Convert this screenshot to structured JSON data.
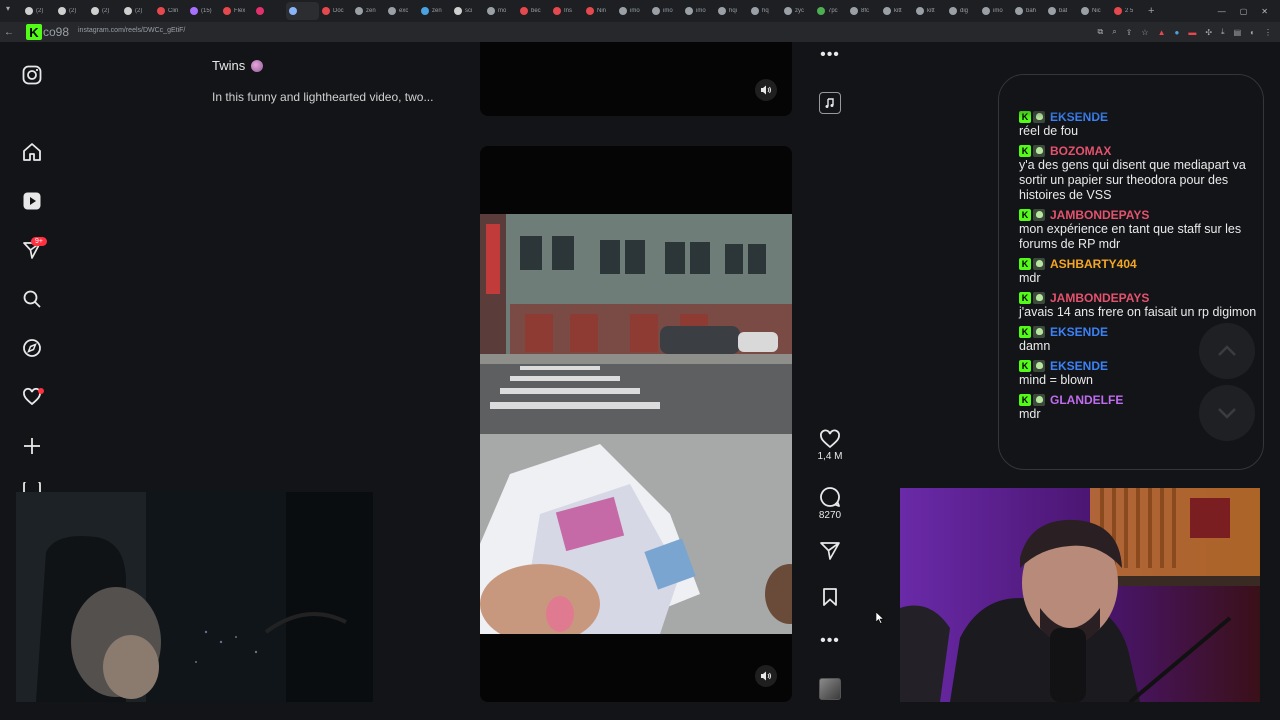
{
  "browser": {
    "tabs": [
      {
        "label": "(2)",
        "color": "#cfcfcf"
      },
      {
        "label": "(2)",
        "color": "#cfcfcf"
      },
      {
        "label": "(2)",
        "color": "#cfcfcf"
      },
      {
        "label": "(2)",
        "color": "#cfcfcf"
      },
      {
        "label": "Clin",
        "color": "#e5484d"
      },
      {
        "label": "(15)",
        "color": "#a970ff"
      },
      {
        "label": "Flex",
        "color": "#e5484d"
      },
      {
        "label": "",
        "color": "#e1306c"
      },
      {
        "label": "",
        "color": "#8ab4f8"
      },
      {
        "label": "Doc",
        "color": "#e5484d"
      },
      {
        "label": "zen",
        "color": "#9aa0a6"
      },
      {
        "label": "exc",
        "color": "#9aa0a6"
      },
      {
        "label": "zen",
        "color": "#4aa3df"
      },
      {
        "label": "sci",
        "color": "#cfcfcf"
      },
      {
        "label": "mo",
        "color": "#9aa0a6"
      },
      {
        "label": "bec",
        "color": "#e5484d"
      },
      {
        "label": "Ins",
        "color": "#e5484d"
      },
      {
        "label": "Nin",
        "color": "#e5484d"
      },
      {
        "label": "imo",
        "color": "#9aa0a6"
      },
      {
        "label": "imo",
        "color": "#9aa0a6"
      },
      {
        "label": "imo",
        "color": "#9aa0a6"
      },
      {
        "label": "hqi",
        "color": "#9aa0a6"
      },
      {
        "label": "hq",
        "color": "#9aa0a6"
      },
      {
        "label": "zyc",
        "color": "#9aa0a6"
      },
      {
        "label": "7pc",
        "color": "#4caf50"
      },
      {
        "label": "8fc",
        "color": "#9aa0a6"
      },
      {
        "label": "kitt",
        "color": "#9aa0a6"
      },
      {
        "label": "kitt",
        "color": "#9aa0a6"
      },
      {
        "label": "dig",
        "color": "#9aa0a6"
      },
      {
        "label": "imo",
        "color": "#9aa0a6"
      },
      {
        "label": "bah",
        "color": "#9aa0a6"
      },
      {
        "label": "bat",
        "color": "#9aa0a6"
      },
      {
        "label": "Nic",
        "color": "#9aa0a6"
      },
      {
        "label": "2 5",
        "color": "#e5484d"
      }
    ],
    "url": "instagram.com/reels/DWCc_gEtiF/",
    "logo_letter": "K",
    "logo_text": "co98"
  },
  "post": {
    "author": "Twins",
    "description": "In this funny and lighthearted video, two..."
  },
  "actions": {
    "likes": "1,4 M",
    "comments": "8270"
  },
  "chat": {
    "messages": [
      {
        "user": "EKSENDE",
        "color": "#3b82f6",
        "text": "réel de fou"
      },
      {
        "user": "BOZOMAX",
        "color": "#e5526d",
        "text": "y'a des gens qui disent que mediapart va sortir un papier sur theodora pour des histoires de VSS"
      },
      {
        "user": "JAMBONDEPAYS",
        "color": "#e5526d",
        "text": "mon expérience en tant que staff sur les forums de RP mdr"
      },
      {
        "user": "ASHBARTY404",
        "color": "#f5a623",
        "text": "mdr"
      },
      {
        "user": "JAMBONDEPAYS",
        "color": "#e5526d",
        "text": "j'avais 14 ans frere on faisait un rp digimon"
      },
      {
        "user": "EKSENDE",
        "color": "#3b82f6",
        "text": "damn"
      },
      {
        "user": "EKSENDE",
        "color": "#3b82f6",
        "text": "mind = blown"
      },
      {
        "user": "GLANDELFE",
        "color": "#c06cf0",
        "text": "mdr"
      }
    ]
  },
  "nav": {
    "notifications_badge": "9+"
  }
}
